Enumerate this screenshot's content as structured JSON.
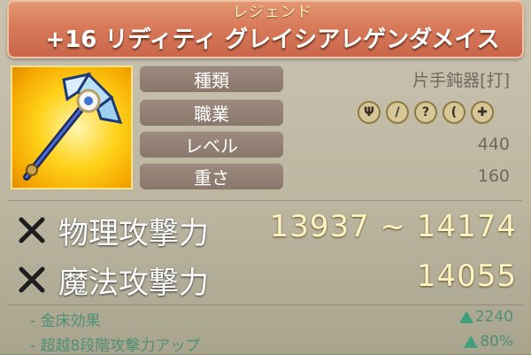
{
  "tooltip": {
    "rarity": "レジェンド",
    "name": "+16 リディティ グレイシアレゲンダメイス"
  },
  "stats": [
    {
      "label": "種類",
      "value": "片手鈍器[打]"
    },
    {
      "label": "職業",
      "value": ""
    },
    {
      "label": "レベル",
      "value": "440"
    },
    {
      "label": "重さ",
      "value": "160"
    }
  ],
  "class_icons": [
    "claw-icon",
    "sword-icon",
    "staff-icon",
    "bow-icon",
    "cross-icon"
  ],
  "attack": {
    "physical": {
      "label": "物理攻撃力",
      "value": "13937 ~ 14174"
    },
    "magic": {
      "label": "魔法攻撃力",
      "value": "14055"
    }
  },
  "bonuses": [
    {
      "label": "- 金床効果",
      "value": "2240"
    },
    {
      "label": "- 超越8段階攻撃力アップ",
      "value": "80%"
    }
  ],
  "colors": {
    "banner": "#d87a5a",
    "gold": "#fff3c2",
    "bonus_green": "#4e8f76"
  }
}
